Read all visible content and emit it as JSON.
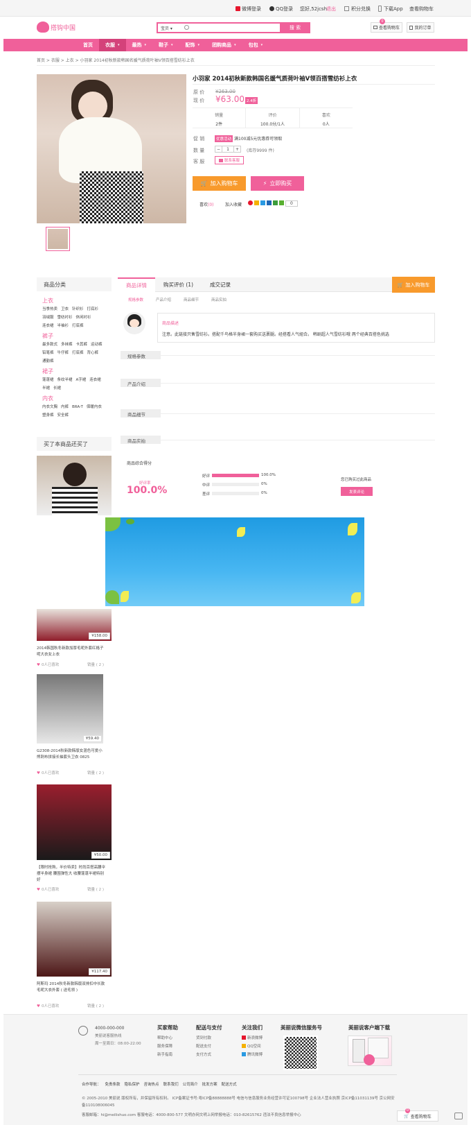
{
  "topbar": {
    "weibo": "微博登录",
    "qq": "QQ登录",
    "hello": "您好,52jcsh",
    "logout": "退出",
    "points": "积分兑换",
    "app": "下载App",
    "cart": "查看购物车"
  },
  "header": {
    "logo": "搭钩中国",
    "search_cat": "宝贝",
    "search_btn": "搜 索",
    "cart_btn": "查看购物车",
    "cart_count": "0",
    "orders_btn": "我的订单"
  },
  "nav": {
    "items": [
      "首页",
      "衣服",
      "最热",
      "鞋子",
      "配饰",
      "团购商品",
      "包包"
    ]
  },
  "breadcrumb": "首页 > 衣服 > 上衣 > 小羽家 2014初秋新款韩国名媛气质荷叶袖V领百搭雪纺衫上衣",
  "product": {
    "title": "小羽家 2014初秋新款韩国名媛气质荷叶袖V领百搭雪纺衫上衣",
    "orig_label": "原 价",
    "orig_price": "¥263.00",
    "price_label": "现 价",
    "price": "¥63.00",
    "discount": "2.4折",
    "stats": [
      {
        "label": "销量",
        "value": "2件"
      },
      {
        "label": "评价",
        "value": "100.0分/1人"
      },
      {
        "label": "喜欢",
        "value": "0人"
      }
    ],
    "promo_label": "促 销",
    "promo_badge": "优惠活动",
    "promo_text": "满100减5元优惠券可领取",
    "qty_label": "数 量",
    "qty": "1",
    "stock": "(库存9999 件)",
    "service_label": "客 服",
    "service_btn": "联系客服",
    "add_cart": "加入购物车",
    "buy_now": "立即购买",
    "like": "喜欢",
    "like_count": "(0)",
    "share": "加入收藏",
    "share_count": "0"
  },
  "tabs": {
    "items": [
      "商品详情",
      "购买评价 (1)",
      "成交记录"
    ],
    "add_cart": "加入购物车",
    "sub": [
      "规格参数",
      "产品介绍",
      "商品细节",
      "商品实拍"
    ]
  },
  "remark": {
    "title": "商品描述",
    "text": "注意。此链接只售雪纺衫。搭配千鸟格半身裙一套购买送裹腿。经搭看人气組合。 韩剧超人气雪纺衫哦 两个经典百搭色挑选"
  },
  "sections": [
    "规格参数",
    "产品介绍",
    "商品细节",
    "商品实拍"
  ],
  "rating": {
    "title": "商品综合得分",
    "score_label": "好评率",
    "score": "100.0%",
    "rows": [
      {
        "label": "好评",
        "pct": "100.0%",
        "fill": 1.0
      },
      {
        "label": "中评",
        "pct": "0%",
        "fill": 0
      },
      {
        "label": "差评",
        "pct": "0%",
        "fill": 0
      }
    ],
    "bought": "您已购买过此商品",
    "review_btn": "发表评论"
  },
  "sidebar": {
    "title": "商品分类",
    "groups": [
      {
        "name": "上衣",
        "items": [
          "当季热卖",
          "卫衣",
          "针织衫",
          "打底衫",
          "羽绒服",
          "雪纺衬衫",
          "休闲衬衫",
          "连衣裙",
          "半袖衫",
          "打底裤"
        ]
      },
      {
        "name": "裤子",
        "items": [
          "最多款式",
          "多袜裤",
          "卡其裤",
          "运动裤",
          "铅笔裤",
          "牛仔裤",
          "打底裤",
          "背心裤",
          "通勤裤"
        ]
      },
      {
        "name": "裙子",
        "items": [
          "蓬蓬裙",
          "条纹半裙",
          "A字裙",
          "连衣裙",
          "半裙",
          "长裙"
        ]
      },
      {
        "name": "内衣",
        "items": [
          "内衣文胸",
          "内裤",
          "BRA-T",
          "保暖内衣",
          "塑身裤",
          "安全裤"
        ]
      }
    ],
    "bought_title": "买了本商品还买了",
    "products": [
      {
        "price": "¥158.00",
        "title": "2014韩国秋冬新款加厚毛呢外套红格子呢大衣女上衣",
        "likes": "0人已喜欢",
        "sales": "销量 ( 2 )"
      },
      {
        "price": "¥59.40",
        "title": "G2308-2014秋新款韩版女混色可爱小熊刺布拼接长袖套头卫衣 0825",
        "likes": "0人已喜欢",
        "sales": "销量 ( 2 )"
      },
      {
        "price": "¥50.00",
        "title": "【限时抢购，半价特卖】时尚百搭高腰伞摆半身裙 腰围弹性大 收腰蓬蓬半裙特别好",
        "likes": "0人已喜欢",
        "sales": "销量 ( 2 )"
      },
      {
        "price": "¥117.40",
        "title": "阿斯玛 2014秋冬新款韩版双排扣中长款毛呢大衣外套 ( 送毛领 )",
        "likes": "0人已喜欢",
        "sales": "销量 ( 2 )"
      }
    ]
  },
  "footer": {
    "phone": "4000-000-000",
    "phone_sub": "美丽说客服热线",
    "hours": "周一至周日：08:00-22:00",
    "cols": [
      {
        "title": "买家帮助",
        "items": [
          "帮助中心",
          "服务保障",
          "新手指南"
        ]
      },
      {
        "title": "配送与支付",
        "items": [
          "货到付款",
          "配送支付",
          "支付方式"
        ]
      },
      {
        "title": "关注我们",
        "items": [
          "新浪微博",
          "QQ空间",
          "腾讯微博"
        ]
      }
    ],
    "wechat_title": "美丽说微信服务号",
    "app_title": "美丽说客户端下载",
    "links": [
      "合作导航：",
      "免责条款",
      "隐私保护",
      "咨询热点",
      "联系我们",
      "公司简介",
      "批发方案",
      "配送方式"
    ],
    "copyright": "© 2005-2010 美丽说 版权所有，并保留所有权利。 ICP备案证书号:粤ICP备88888888号   电信与信息服务业务经营许可证100798号   企业法人营业执照   京ICP备11031139号   京公网安备110108006045",
    "contact": "客服邮箱：hi@meilishuo.com  客服电话：4000-800-577  文明办网文明上网举报电话：010-82615762  违法不良信息举报中心",
    "fixed_cart": "查看购物车",
    "fixed_cart_count": "0"
  }
}
